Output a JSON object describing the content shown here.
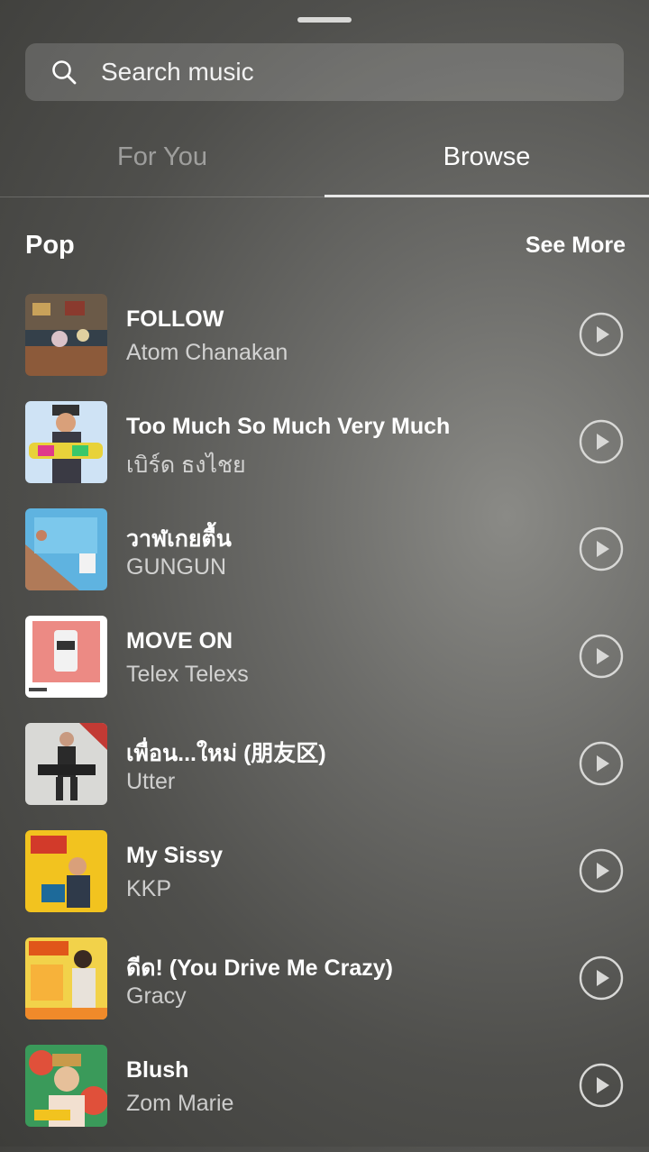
{
  "search": {
    "placeholder": "Search music",
    "icon": "search-icon"
  },
  "tabs": [
    {
      "label": "For You",
      "active": false
    },
    {
      "label": "Browse",
      "active": true
    }
  ],
  "section": {
    "title": "Pop",
    "see_more": "See More"
  },
  "tracks": [
    {
      "title": "FOLLOW",
      "artist": "Atom Chanakan"
    },
    {
      "title": "Too Much So Much Very Much",
      "artist": "เบิร์ด ธงไชย"
    },
    {
      "title": "วาฬเกยตื้น",
      "artist": "GUNGUN"
    },
    {
      "title": "MOVE ON",
      "artist": "Telex Telexs"
    },
    {
      "title": "เพื่อน...ใหม่ (朋友区)",
      "artist": "Utter"
    },
    {
      "title": "My Sissy",
      "artist": "KKP"
    },
    {
      "title": "ดีด! (You Drive Me Crazy)",
      "artist": "Gracy"
    },
    {
      "title": "Blush",
      "artist": "Zom Marie"
    }
  ],
  "colors": {
    "accent": "#ffffff",
    "muted": "#a6a6a3"
  }
}
